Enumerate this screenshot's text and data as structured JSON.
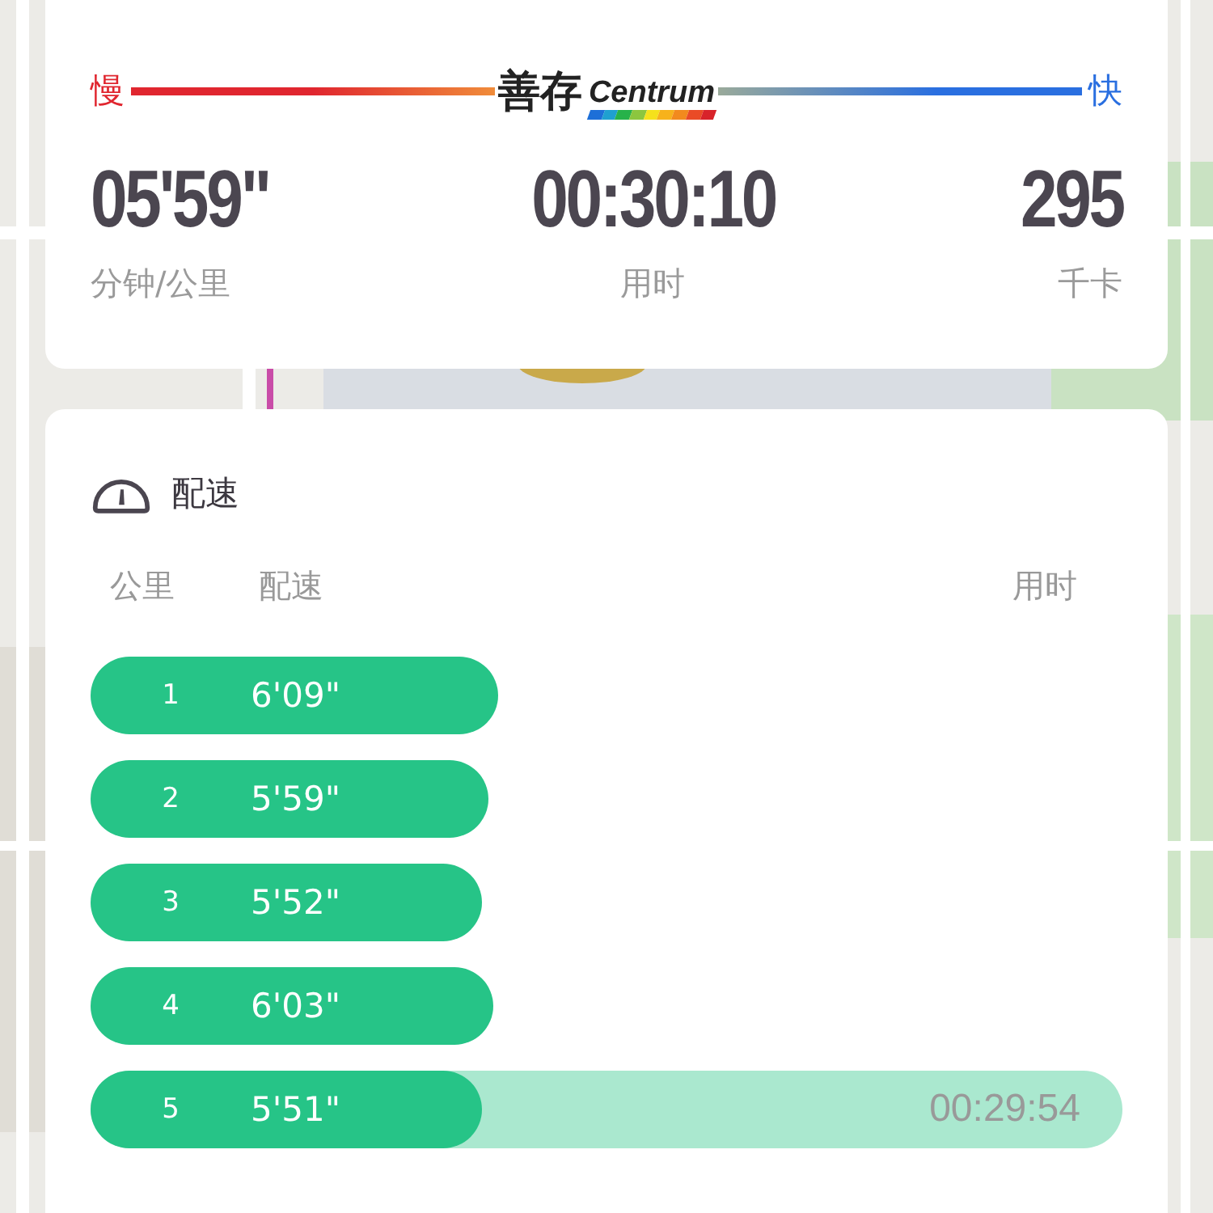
{
  "scale": {
    "slow": "慢",
    "fast": "快",
    "brand_cn": "善存",
    "brand_en": "Centrum"
  },
  "stats": [
    {
      "value": "05'59\"",
      "label": "分钟/公里"
    },
    {
      "value": "00:30:10",
      "label": "用时"
    },
    {
      "value": "295",
      "label": "千卡"
    }
  ],
  "pace_panel": {
    "title": "配速",
    "columns": [
      "公里",
      "配速",
      "用时"
    ],
    "rows": [
      {
        "km": "1",
        "pace": "6'09\"",
        "level": 0.395,
        "selected": false
      },
      {
        "km": "2",
        "pace": "5'59\"",
        "level": 0.386,
        "selected": false
      },
      {
        "km": "3",
        "pace": "5'52\"",
        "level": 0.379,
        "selected": false
      },
      {
        "km": "4",
        "pace": "6'03\"",
        "level": 0.39,
        "selected": false
      },
      {
        "km": "5",
        "pace": "5'51\"",
        "level": 0.379,
        "selected": true,
        "time": "00:29:54"
      }
    ]
  }
}
